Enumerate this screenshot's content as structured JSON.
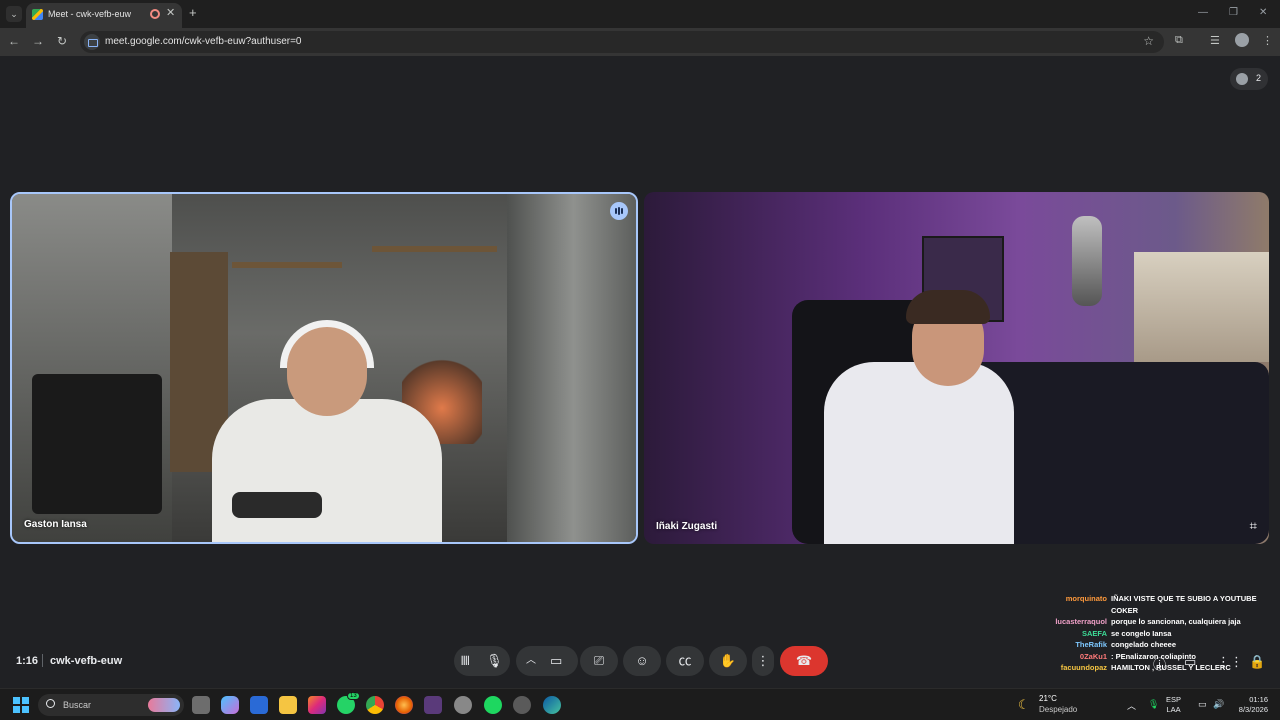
{
  "browser": {
    "tab_title": "Meet - cwk-vefb-euw",
    "url": "meet.google.com/cwk-vefb-euw?authuser=0"
  },
  "meet": {
    "participant_count": "2",
    "participants": [
      {
        "name": "Gaston Iansa",
        "speaking": true
      },
      {
        "name": "Iñaki Zugasti",
        "speaking": false
      }
    ],
    "meeting_time": "1:16",
    "meeting_code": "cwk-vefb-euw",
    "colors": {
      "speaking_border": "#a8c7fa",
      "end_call": "#dc362e",
      "control_bg": "#333537"
    }
  },
  "chat": [
    {
      "user": "morquinato",
      "color": "#ff9a3c",
      "message": "IÑAKI VISTE QUE TE SUBIO A YOUTUBE COKER"
    },
    {
      "user": "lucasterraquol",
      "color": "#f0a0c8",
      "message": "porque lo sancionan, cualquiera jaja"
    },
    {
      "user": "SAEFA",
      "color": "#3ddc97",
      "message": "se congelo Iansa"
    },
    {
      "user": "TheRafik",
      "color": "#7ec8ff",
      "message": "congelado cheeee"
    },
    {
      "user": "0ZaKu1",
      "color": "#ff7a7a",
      "message": ": PEnalizaron coliapinto"
    },
    {
      "user": "facuundopaz",
      "color": "#f5c542",
      "message": "HAMILTON , RUSSEL Y LECLERC"
    }
  ],
  "taskbar": {
    "search_placeholder": "Buscar",
    "weather_temp": "21°C",
    "weather_desc": "Despejado",
    "lang_1": "ESP",
    "lang_2": "LAA",
    "time": "01:16",
    "date": "8/3/2026",
    "whatsapp_badge": "13"
  }
}
